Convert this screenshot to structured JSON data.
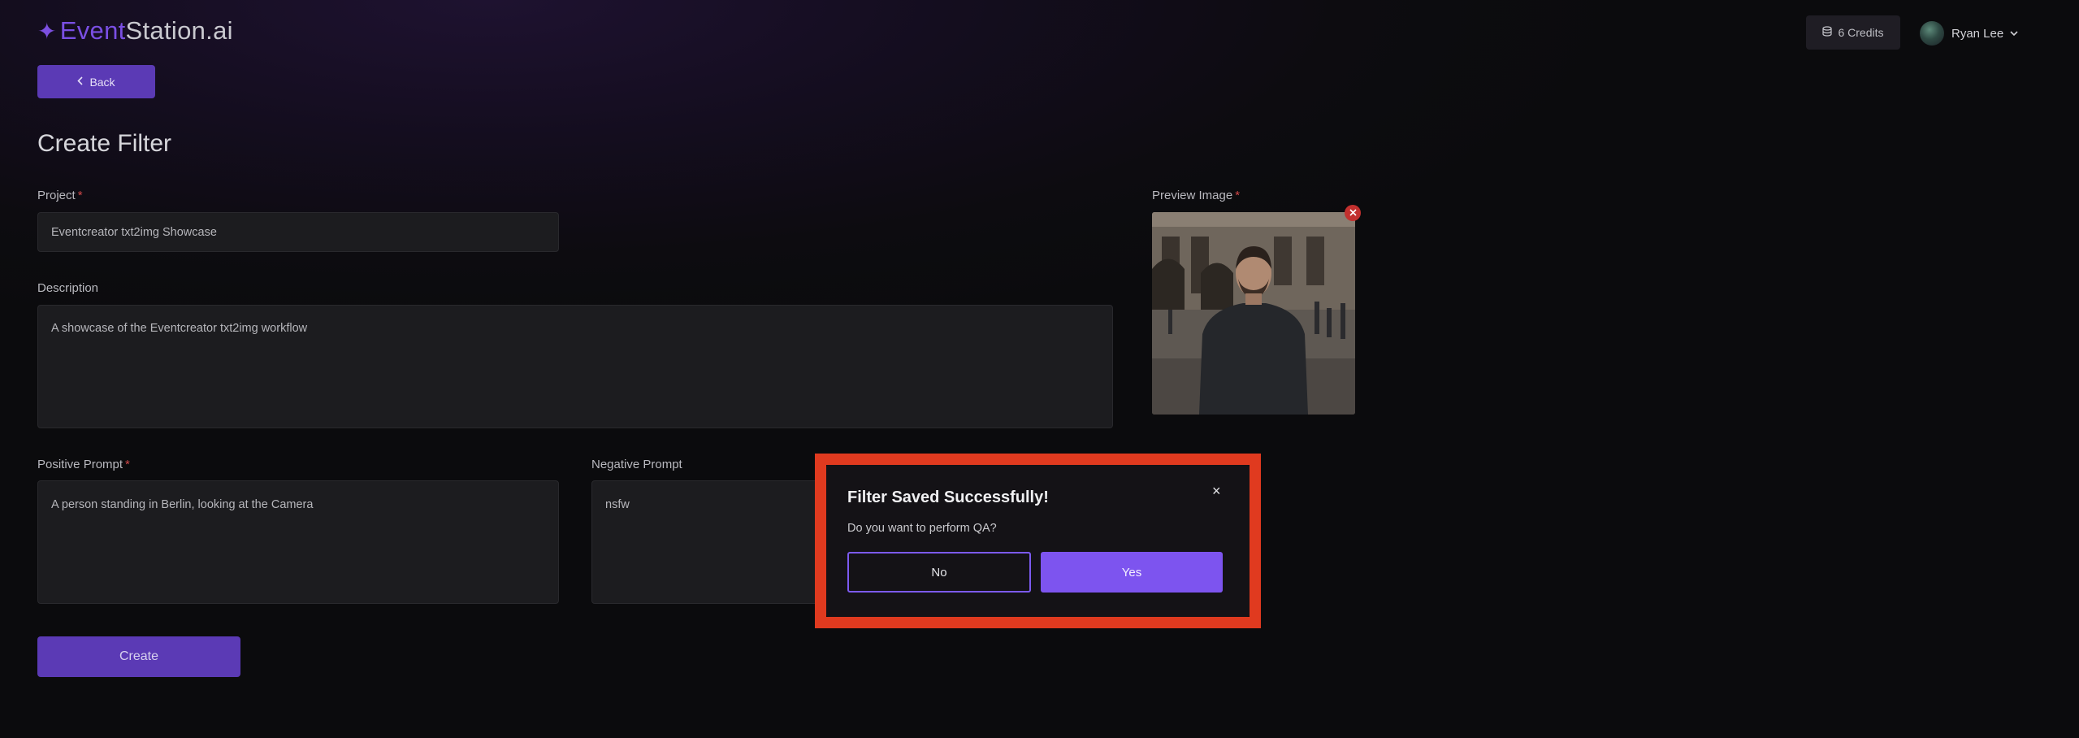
{
  "header": {
    "logo_part1": "EventStation",
    "logo_part2": ".ai",
    "logo_sparkle": "✦",
    "credits_label": "6 Credits",
    "user_name": "Ryan Lee"
  },
  "nav": {
    "back_label": "Back"
  },
  "page": {
    "title": "Create Filter"
  },
  "form": {
    "project_label": "Project",
    "project_value": "Eventcreator txt2img Showcase",
    "description_label": "Description",
    "description_value": "A showcase of the Eventcreator txt2img workflow",
    "positive_prompt_label": "Positive Prompt",
    "positive_prompt_value": "A person standing in Berlin, looking at the Camera",
    "negative_prompt_label": "Negative Prompt",
    "negative_prompt_value": "nsfw",
    "preview_image_label": "Preview Image",
    "required_marker": "*",
    "create_label": "Create"
  },
  "dialog": {
    "title": "Filter Saved Successfully!",
    "message": "Do you want to perform QA?",
    "no_label": "No",
    "yes_label": "Yes",
    "close_glyph": "×"
  },
  "colors": {
    "accent": "#5b3ab5",
    "dialog_accent": "#7d54ef",
    "highlight_outline": "#e03a1f",
    "required": "#d04848",
    "remove_badge": "#c2302e"
  }
}
